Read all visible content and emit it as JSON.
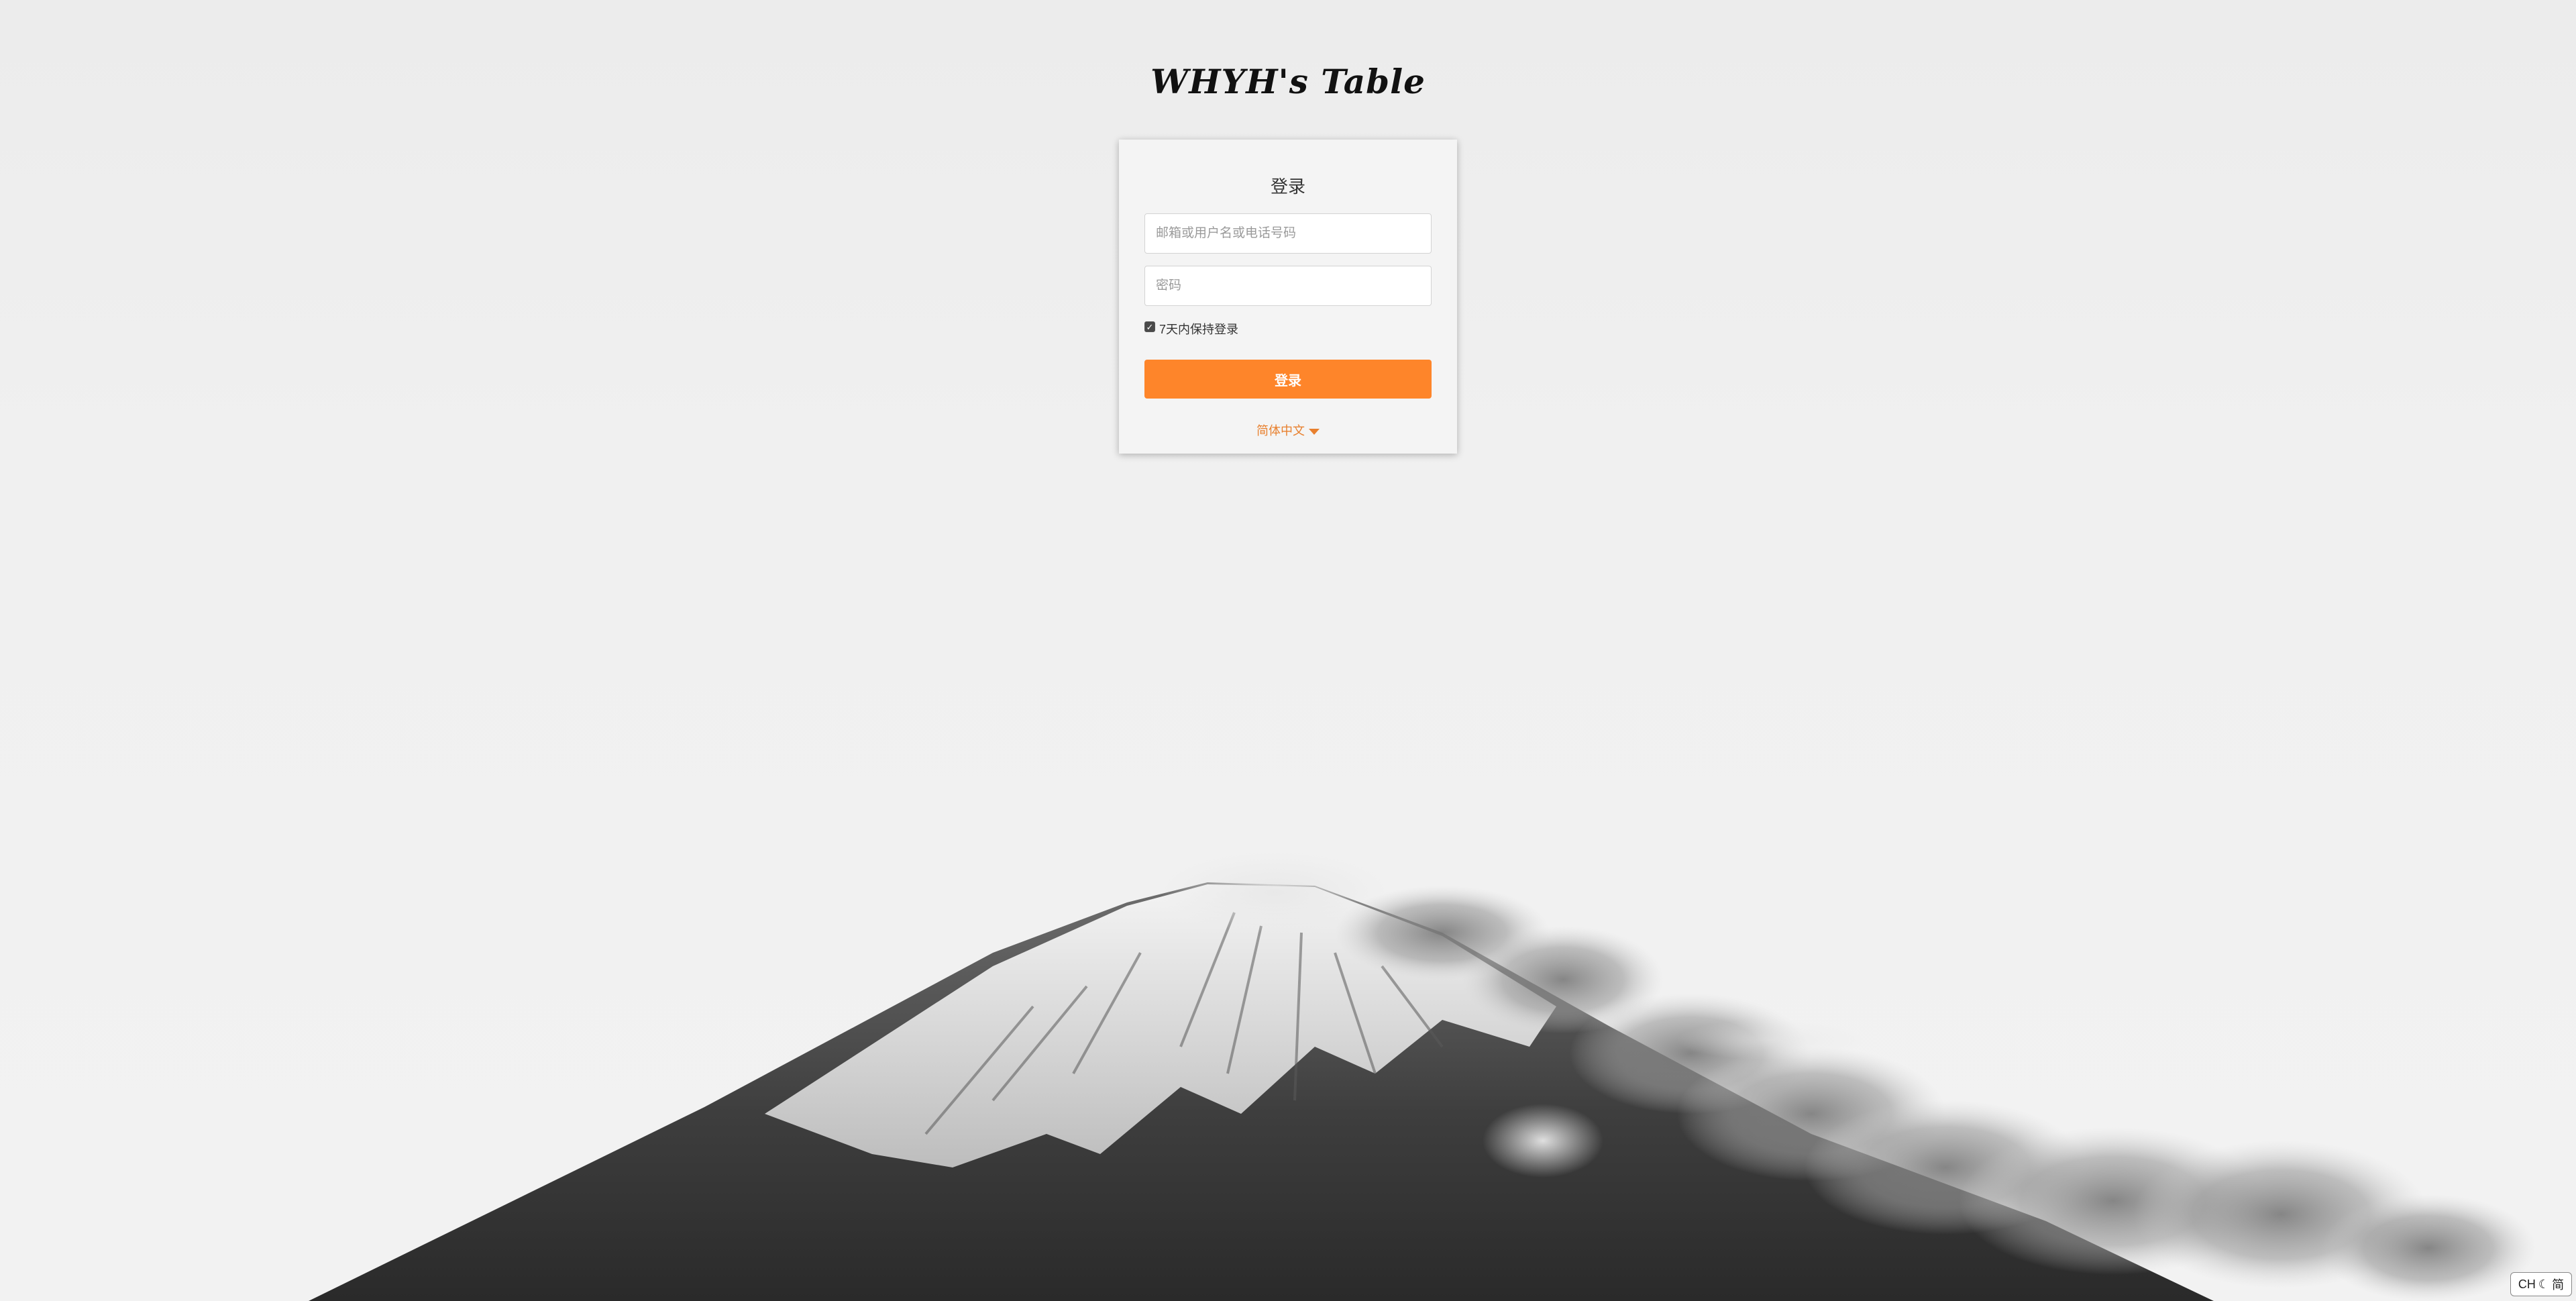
{
  "brand": {
    "title": "WHYH's Table"
  },
  "login": {
    "title": "登录",
    "username_placeholder": "邮箱或用户名或电话号码",
    "password_placeholder": "密码",
    "remember_label": "7天内保持登录",
    "remember_checked": true,
    "submit_label": "登录",
    "language_label": "简体中文"
  },
  "ime": {
    "layout": "CH",
    "mode": "简"
  },
  "colors": {
    "accent": "#fe852a",
    "link": "#e8802e",
    "background": "#efefef"
  },
  "icons": [
    "caret-down-icon",
    "checkbox-check-icon",
    "moon-icon"
  ]
}
